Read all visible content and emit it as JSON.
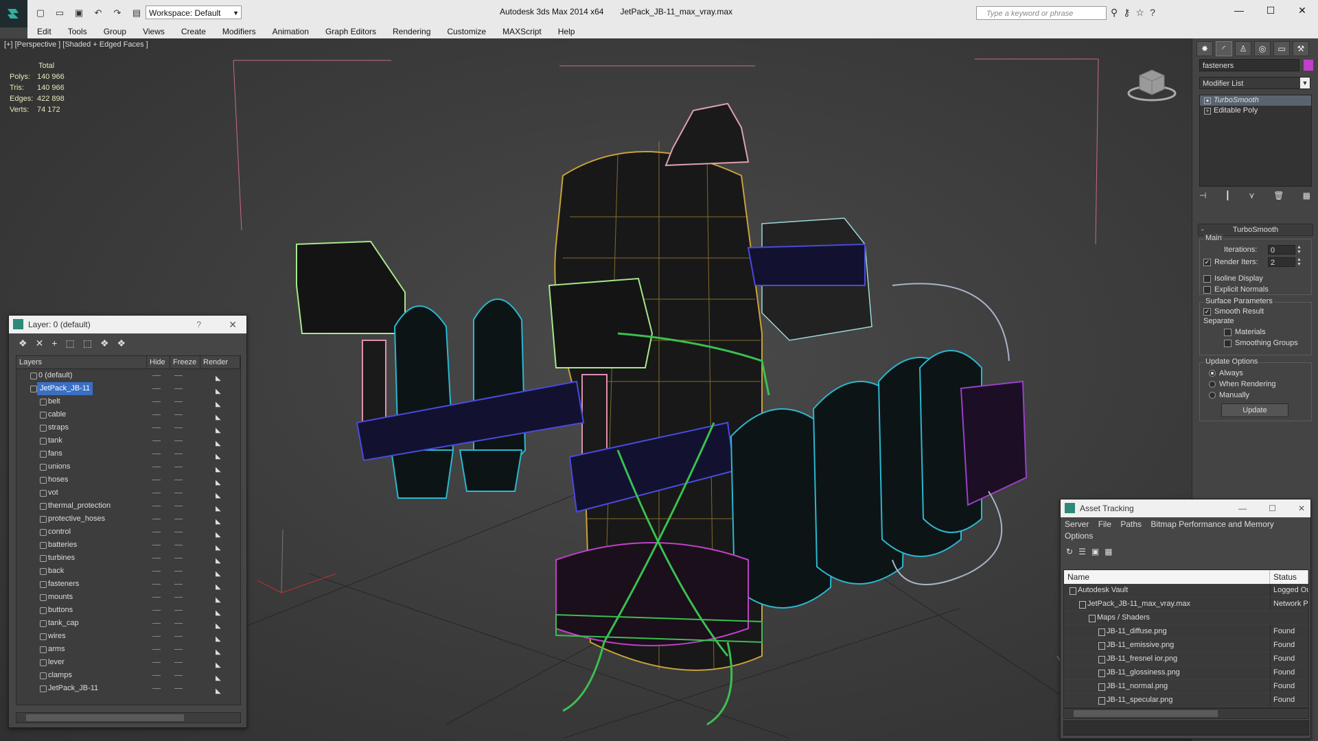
{
  "titlebar": {
    "app_title": "Autodesk 3ds Max  2014 x64",
    "file_title": "JetPack_JB-11_max_vray.max",
    "workspace": "Workspace: Default",
    "search_placeholder": "Type a keyword or phrase"
  },
  "menu": [
    "Edit",
    "Tools",
    "Group",
    "Views",
    "Create",
    "Modifiers",
    "Animation",
    "Graph Editors",
    "Rendering",
    "Customize",
    "MAXScript",
    "Help"
  ],
  "viewport": {
    "label": "[+] [Perspective ] [Shaded + Edged Faces ]",
    "stats": {
      "header": "Total",
      "polys_label": "Polys:",
      "polys": "140 966",
      "tris_label": "Tris:",
      "tris": "140 966",
      "edges_label": "Edges:",
      "edges": "422 898",
      "verts_label": "Verts:",
      "verts": "74 172"
    }
  },
  "command_panel": {
    "object_name": "fasteners",
    "object_color": "#c040c8",
    "modifier_list": "Modifier List",
    "stack": [
      "TurboSmooth",
      "Editable Poly"
    ],
    "rollout_title": "TurboSmooth",
    "main_label": "Main",
    "iterations_label": "Iterations:",
    "iterations": "0",
    "render_iters_label": "Render Iters:",
    "render_iters": "2",
    "isoline": "Isoline Display",
    "explicit_normals": "Explicit Normals",
    "surface_params": "Surface Parameters",
    "smooth_result": "Smooth Result",
    "separate": "Separate",
    "materials": "Materials",
    "smoothing_groups": "Smoothing Groups",
    "update_options": "Update Options",
    "always": "Always",
    "when_rendering": "When Rendering",
    "manually": "Manually",
    "update_btn": "Update"
  },
  "layer_panel": {
    "title": "Layer: 0 (default)",
    "help": "?",
    "columns": [
      "Layers",
      "Hide",
      "Freeze",
      "Render"
    ],
    "top_layers": [
      "0 (default)",
      "JetPack_JB-11"
    ],
    "sublayers": [
      "belt",
      "cable",
      "straps",
      "tank",
      "fans",
      "unions",
      "hoses",
      "vot",
      "thermal_protection",
      "protective_hoses",
      "control",
      "batteries",
      "turbines",
      "back",
      "fasteners",
      "mounts",
      "buttons",
      "tank_cap",
      "wires",
      "arms",
      "lever",
      "clamps",
      "JetPack_JB-11"
    ]
  },
  "asset_panel": {
    "title": "Asset Tracking",
    "menu": [
      "Server",
      "File",
      "Paths",
      "Bitmap Performance and Memory",
      "Options"
    ],
    "columns": [
      "Name",
      "Status"
    ],
    "rows": [
      {
        "name": "Autodesk Vault",
        "status": "Logged Out"
      },
      {
        "name": "JetPack_JB-11_max_vray.max",
        "status": "Network Pa"
      },
      {
        "name": "Maps / Shaders",
        "status": ""
      },
      {
        "name": "JB-11_diffuse.png",
        "status": "Found"
      },
      {
        "name": "JB-11_emissive.png",
        "status": "Found"
      },
      {
        "name": "JB-11_fresnel ior.png",
        "status": "Found"
      },
      {
        "name": "JB-11_glossiness.png",
        "status": "Found"
      },
      {
        "name": "JB-11_normal.png",
        "status": "Found"
      },
      {
        "name": "JB-11_specular.png",
        "status": "Found"
      }
    ]
  }
}
